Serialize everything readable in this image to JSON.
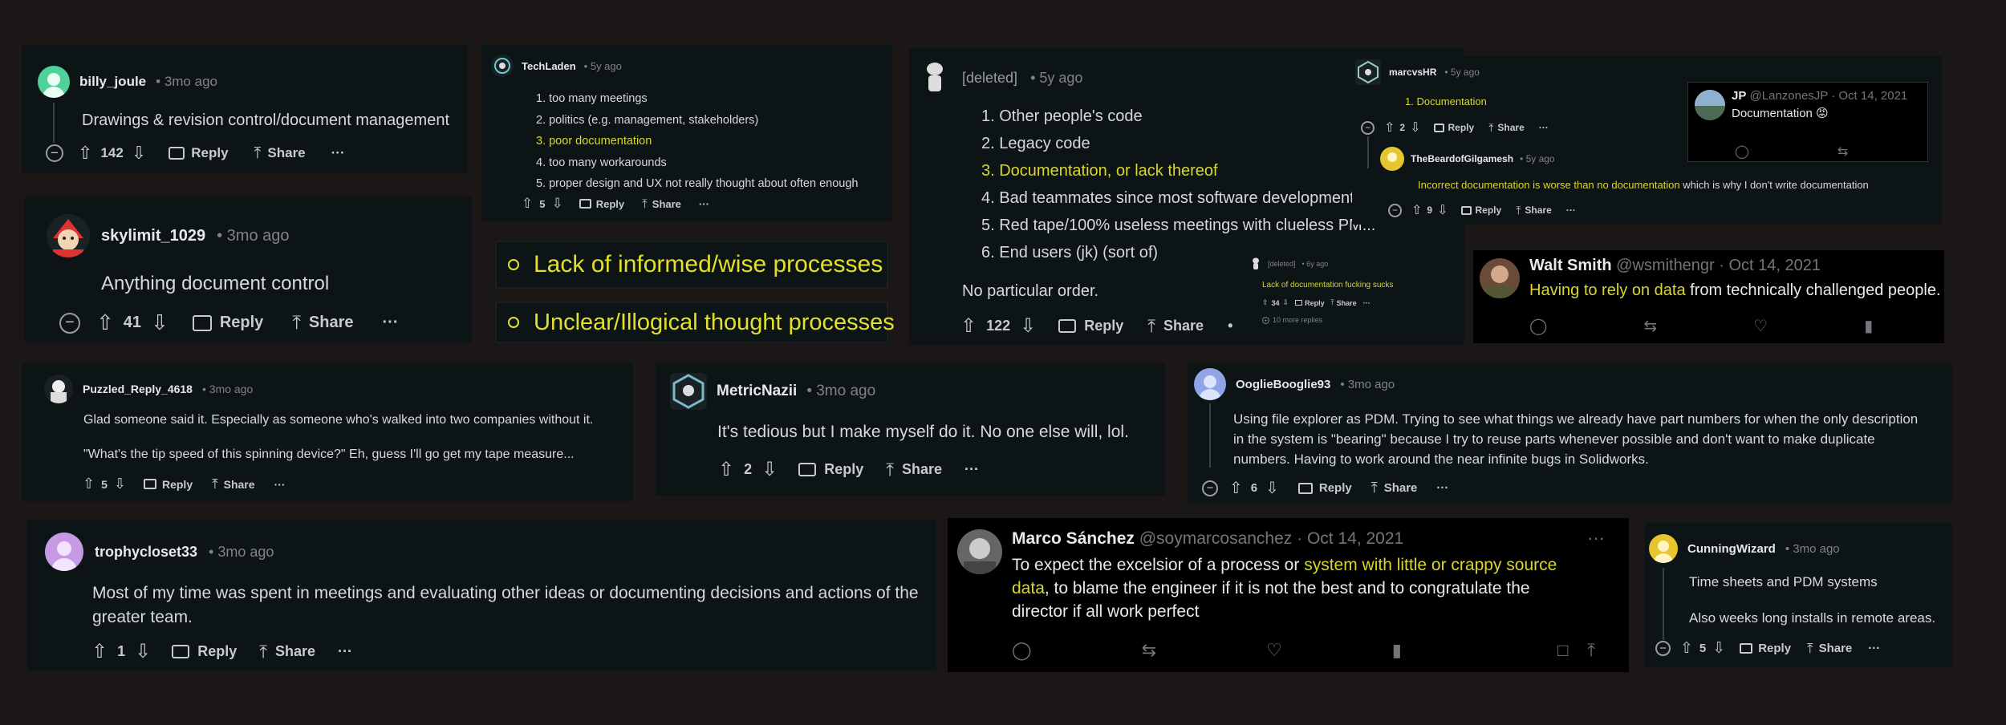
{
  "common": {
    "reply": "Reply",
    "share": "Share",
    "more": "···"
  },
  "icons": {
    "upvote": "upvote-icon",
    "downvote": "downvote-icon",
    "comment": "comment-icon",
    "share": "share-icon",
    "collapse": "collapse-icon",
    "retweet": "retweet-icon",
    "like": "like-icon",
    "views": "views-icon",
    "bookmark": "bookmark-icon"
  },
  "colors": {
    "highlight": "#d9d62c",
    "card_bg": "#0d1416",
    "page_bg": "#1c1717",
    "tweet_bg": "#000000"
  },
  "c1": {
    "user": "billy_joule",
    "time": "• 3mo ago",
    "text": "Drawings & revision control/document management",
    "votes": "142"
  },
  "c2": {
    "user": "skylimit_1029",
    "time": "• 3mo ago",
    "text": "Anything document control",
    "votes": "41"
  },
  "c3": {
    "user": "TechLaden",
    "time": "• 5y ago",
    "items": [
      "1. too many meetings",
      "2. politics (e.g. management, stakeholders)",
      "3. poor documentation",
      "4. too many workarounds",
      "5. proper design and UX not really thought about often enough"
    ],
    "votes": "5"
  },
  "bars": [
    "Lack of informed/wise processes",
    "Unclear/Illogical thought processes"
  ],
  "c4": {
    "user": "[deleted]",
    "time": "• 5y ago",
    "items": [
      "1. Other people's code",
      "2. Legacy code",
      "3. Documentation, or lack thereof",
      "4. Bad teammates since most software development",
      "5. Red tape/100% useless meetings with clueless PM...",
      "6. End users (jk) (sort of)"
    ],
    "note": "No particular order.",
    "votes": "122",
    "dot": "•"
  },
  "c4b": {
    "user": "[deleted]",
    "time": "• 6y ago",
    "text": "Lack of documentation fucking sucks",
    "votes": "34",
    "more_replies": "10 more replies"
  },
  "c5": {
    "user": "marcvsHR",
    "time": "• 5y ago",
    "text": "1. Documentation",
    "votes": "2"
  },
  "c5b": {
    "user": "TheBeardofGilgamesh",
    "time": "• 5y ago",
    "text_hl": "Incorrect documentation is worse than no documentation",
    "text_rest": " which is why I don't write documentation",
    "votes": "9"
  },
  "t1": {
    "name": "JP",
    "handle": "@LanzonesJP · Oct 14, 2021",
    "text": "Documentation 😡"
  },
  "t2": {
    "name": "Walt Smith",
    "handle": "@wsmithengr · Oct 14, 2021",
    "text_hl": "Having to rely on data",
    "text_rest": " from technically challenged people."
  },
  "c6": {
    "user": "Puzzled_Reply_4618",
    "time": "• 3mo ago",
    "line1": "Glad someone said it. Especially as someone who's walked into two companies without it.",
    "line2": "\"What's the tip speed of this spinning device?\" Eh, guess I'll go get my tape measure...",
    "votes": "5"
  },
  "c7": {
    "user": "MetricNazii",
    "time": "• 3mo ago",
    "text": "It's tedious but I make myself do it. No one else will, lol.",
    "votes": "2"
  },
  "c8": {
    "user": "OoglieBooglie93",
    "time": "• 3mo ago",
    "lines": [
      "Using file explorer as PDM. Trying to see what things we already have part numbers for when the only description",
      "in the system is \"bearing\" because I try to reuse parts whenever possible and don't want to make duplicate",
      "numbers. Having to work around the near infinite bugs in Solidworks."
    ],
    "votes": "6"
  },
  "c9": {
    "user": "trophycloset33",
    "time": "• 3mo ago",
    "lines": [
      "Most of my time was spent in meetings and evaluating other ideas or documenting decisions and actions of the",
      "greater team."
    ],
    "votes": "1"
  },
  "t3": {
    "name": "Marco Sánchez",
    "handle": "@soymarcosanchez · Oct 14, 2021",
    "line1_a": "To expect the excelsior of a process or ",
    "line1_hl": "system with little or crappy source",
    "line2_hl": "data",
    "line2_rest": ", to blame the engineer if it is not the best and to congratulate the",
    "line3": "director if all work perfect",
    "more": "···"
  },
  "c10": {
    "user": "CunningWizard",
    "time": "• 3mo ago",
    "line1": "Time sheets and PDM systems",
    "line2": "Also weeks long installs in remote areas.",
    "votes": "5"
  }
}
